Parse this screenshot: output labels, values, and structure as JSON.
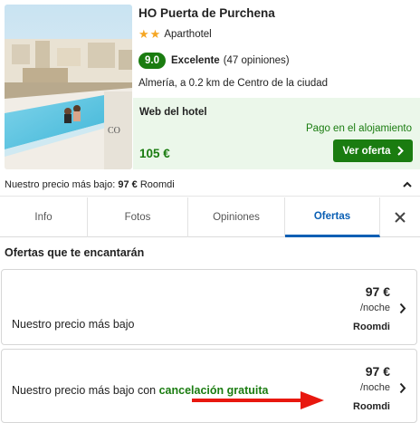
{
  "hotel": {
    "name": "HO Puerta de Purchena",
    "stars": 2,
    "type": "Aparthotel",
    "score": "9.0",
    "rating_label": "Excelente",
    "reviews": "(47 opiniones)",
    "location": "Almería, a 0.2 km de Centro de la ciudad"
  },
  "featured_offer": {
    "source": "Web del hotel",
    "payment": "Pago en el alojamiento",
    "price": "105 €",
    "cta_label": "Ver oferta"
  },
  "lowest_price": {
    "label": "Nuestro precio más bajo:",
    "price": "97 €",
    "provider": "Roomdi"
  },
  "tabs": [
    {
      "label": "Info",
      "active": false
    },
    {
      "label": "Fotos",
      "active": false
    },
    {
      "label": "Opiniones",
      "active": false
    },
    {
      "label": "Ofertas",
      "active": true
    }
  ],
  "section_title": "Ofertas que te encantarán",
  "deals": [
    {
      "label": "Nuestro precio más bajo",
      "price": "97 €",
      "unit": "/noche",
      "provider": "Roomdi"
    },
    {
      "label": "Nuestro precio más bajo con ",
      "label_highlight": "cancelación gratuita",
      "price": "97 €",
      "unit": "/noche",
      "provider": "Roomdi"
    }
  ],
  "colors": {
    "brand_green": "#1a7c10",
    "offer_bg": "#ebf7ea",
    "tab_active": "#0a5fb4",
    "star": "#f5a623",
    "annotation_arrow": "#e8180f"
  },
  "icons": [
    "star-icon",
    "chevron-right-icon",
    "chevron-up-icon",
    "close-icon",
    "arrow-annotation"
  ]
}
